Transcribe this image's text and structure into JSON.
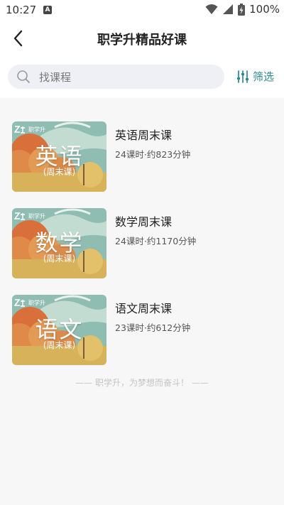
{
  "status_bar": {
    "time": "10:27",
    "notification_badge": "A",
    "battery_percent": "100%"
  },
  "header": {
    "title": "职学升精品好课"
  },
  "search": {
    "placeholder": "找课程",
    "filter_label": "筛选"
  },
  "courses": [
    {
      "thumbnail_brand": "职学升",
      "thumbnail_subject": "英语",
      "thumbnail_tag": "(周末课)",
      "title": "英语周末课",
      "meta": "24课时·约823分钟"
    },
    {
      "thumbnail_brand": "职学升",
      "thumbnail_subject": "数学",
      "thumbnail_tag": "(周末课)",
      "title": "数学周末课",
      "meta": "24课时·约1170分钟"
    },
    {
      "thumbnail_brand": "职学升",
      "thumbnail_subject": "语文",
      "thumbnail_tag": "(周末课)",
      "title": "语文周末课",
      "meta": "23课时·约612分钟"
    }
  ],
  "footer": {
    "slogan": "—— 职学升，为梦想而奋斗！ ——"
  },
  "colors": {
    "accent": "#2a8a8f",
    "search_bg": "#eef0f5",
    "page_bg": "#f7f7f7"
  },
  "icons": {
    "back": "chevron-left-icon",
    "search": "search-icon",
    "filter": "sliders-icon",
    "wifi": "wifi-icon",
    "signal": "signal-icon",
    "battery": "battery-charging-icon"
  }
}
